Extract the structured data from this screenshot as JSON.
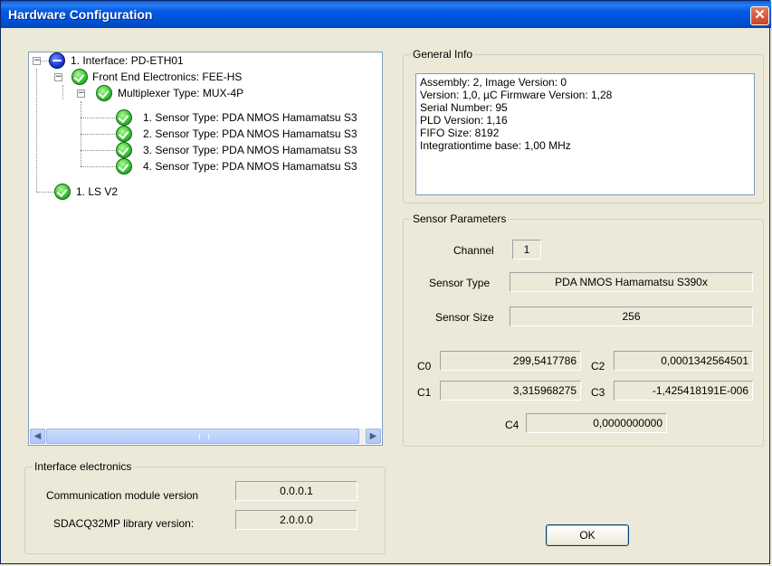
{
  "window": {
    "title": "Hardware Configuration",
    "close_glyph": "✕"
  },
  "tree": {
    "items": [
      {
        "label": "1. Interface: PD-ETH01",
        "icon": "interface-icon"
      },
      {
        "label": "Front End Electronics: FEE-HS",
        "icon": "check-icon"
      },
      {
        "label": "Multiplexer Type: MUX-4P",
        "icon": "check-icon"
      },
      {
        "label": "1. Sensor Type: PDA NMOS Hamamatsu S3",
        "icon": "check-icon"
      },
      {
        "label": "2. Sensor Type: PDA NMOS Hamamatsu S3",
        "icon": "check-icon"
      },
      {
        "label": "3. Sensor Type: PDA NMOS Hamamatsu S3",
        "icon": "check-icon"
      },
      {
        "label": "4. Sensor Type: PDA NMOS Hamamatsu S3",
        "icon": "check-icon"
      },
      {
        "label": "1. LS V2",
        "icon": "check-icon"
      }
    ],
    "expander_glyph": "−",
    "scroll_left": "◀",
    "scroll_right": "▶"
  },
  "general_info": {
    "legend": "General Info",
    "lines": [
      "Assembly: 2, Image Version: 0",
      "Version: 1,0, µC Firmware Version: 1,28",
      "Serial Number: 95",
      "PLD Version: 1,16",
      "FIFO Size: 8192",
      "Integrationtime base: 1,00 MHz"
    ]
  },
  "sensor_params": {
    "legend": "Sensor Parameters",
    "channel_label": "Channel",
    "channel_value": "1",
    "sensor_type_label": "Sensor Type",
    "sensor_type_value": "PDA NMOS Hamamatsu S390x",
    "sensor_size_label": "Sensor Size",
    "sensor_size_value": "256",
    "c0_label": "C0",
    "c0_value": "299,5417786",
    "c1_label": "C1",
    "c1_value": "3,315968275",
    "c2_label": "C2",
    "c2_value": "0,0001342564501",
    "c3_label": "C3",
    "c3_value": "-1,425418191E-006",
    "c4_label": "C4",
    "c4_value": "0,0000000000"
  },
  "interface_electronics": {
    "legend": "Interface electronics",
    "comm_label": "Communication module version",
    "comm_value": "0.0.0.1",
    "lib_label": "SDACQ32MP library version:",
    "lib_value": "2.0.0.0"
  },
  "buttons": {
    "ok": "OK"
  },
  "colors": {
    "titlebar": "#0054e3",
    "dialog_bg": "#ece9d8",
    "ok_icon": "#2fbf2f",
    "interface_icon": "#1b37d6"
  }
}
